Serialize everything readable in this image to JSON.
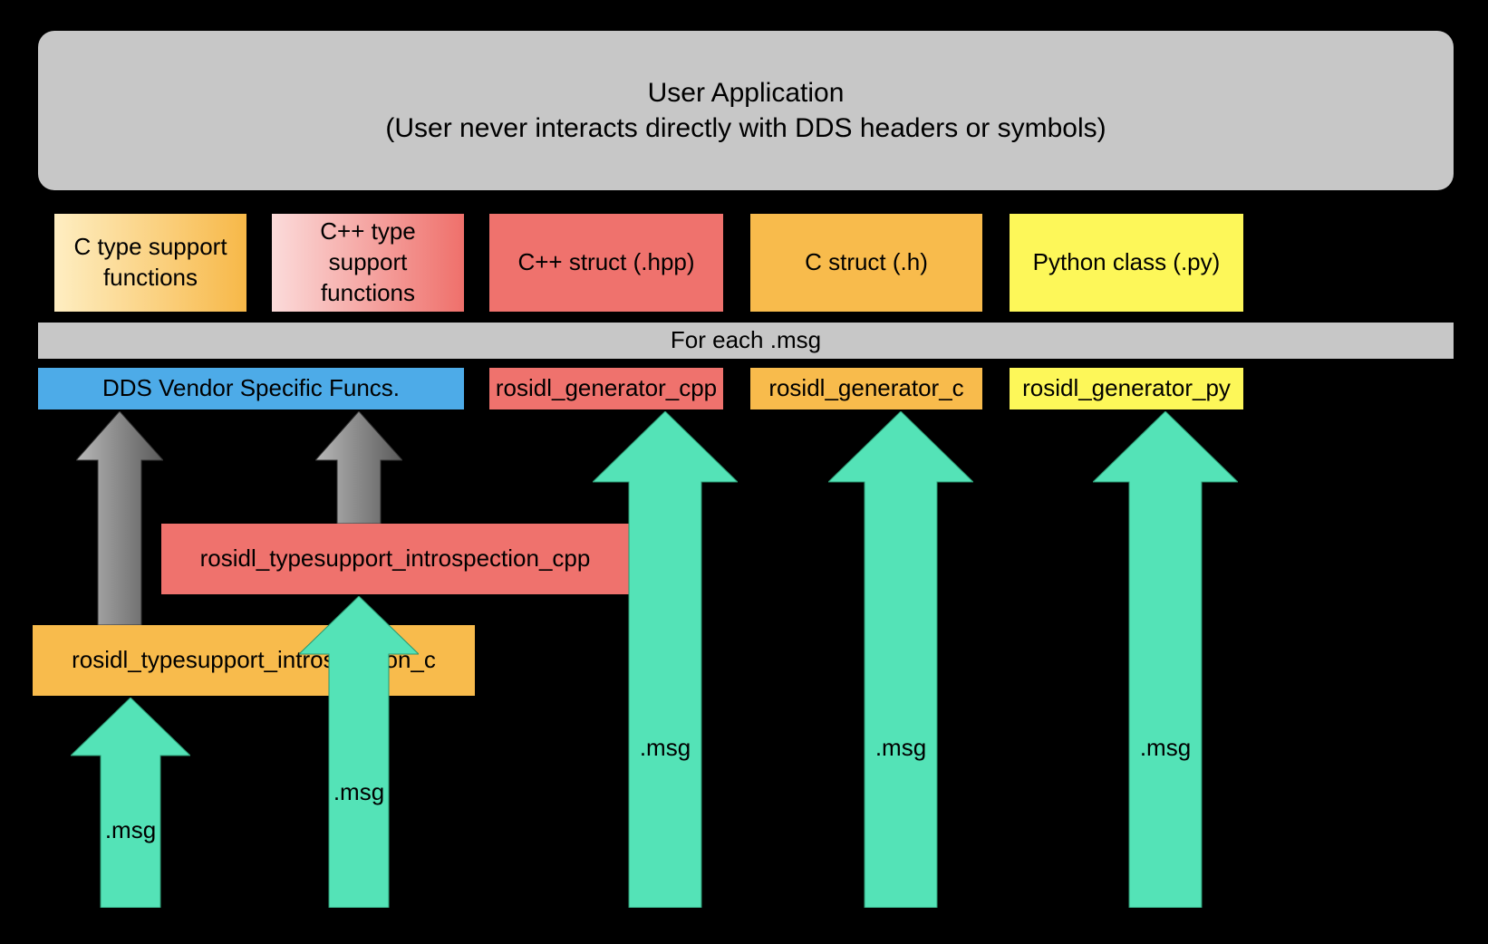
{
  "top": {
    "user_app_line1": "User Application",
    "user_app_line2": "(User never interacts directly with DDS headers or symbols)"
  },
  "row1": {
    "c_type_support": "C type support functions",
    "cpp_type_support": "C++ type support functions",
    "cpp_struct": "C++ struct (.hpp)",
    "c_struct": "C struct (.h)",
    "py_class": "Python class (.py)"
  },
  "strip": {
    "for_each": "For each .msg"
  },
  "row2": {
    "dds_vendor": "DDS Vendor Specific Funcs.",
    "gen_cpp": "rosidl_generator_cpp",
    "gen_c": "rosidl_generator_c",
    "gen_py": "rosidl_generator_py"
  },
  "intro": {
    "cpp": "rosidl_typesupport_introspection_cpp",
    "c": "rosidl_typesupport_introspection_c"
  },
  "msg_label": ".msg"
}
